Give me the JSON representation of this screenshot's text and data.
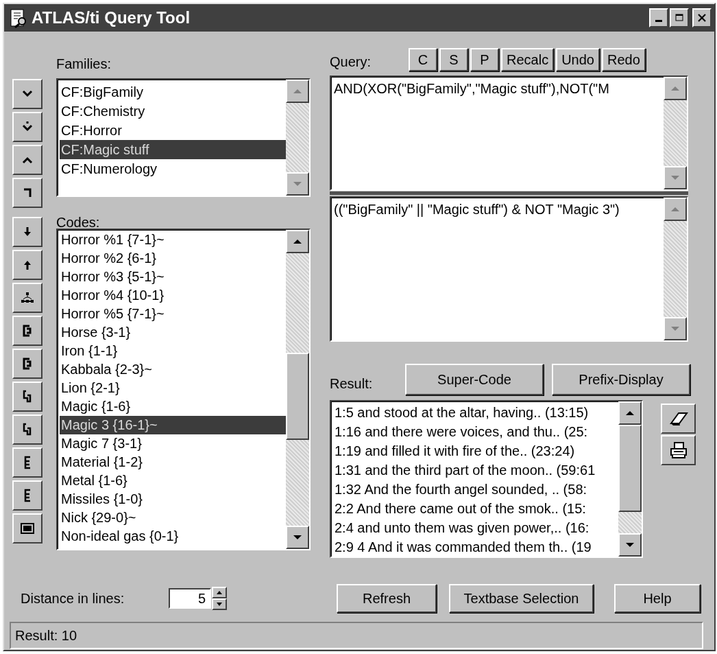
{
  "window": {
    "title": "ATLAS/ti Query Tool"
  },
  "families": {
    "label": "Families:",
    "scroll_enabled": false,
    "items": [
      {
        "text": "CF:BigFamily",
        "selected": false
      },
      {
        "text": "CF:Chemistry",
        "selected": false
      },
      {
        "text": "CF:Horror",
        "selected": false
      },
      {
        "text": "CF:Magic stuff",
        "selected": true
      },
      {
        "text": "CF:Numerology",
        "selected": false
      }
    ]
  },
  "codes": {
    "label": "Codes:",
    "scroll_enabled": true,
    "items": [
      {
        "text": "Horror %1 {7-1}~",
        "selected": false
      },
      {
        "text": "Horror %2 {6-1}",
        "selected": false
      },
      {
        "text": "Horror %3 {5-1}~",
        "selected": false
      },
      {
        "text": "Horror %4 {10-1}",
        "selected": false
      },
      {
        "text": "Horror %5 {7-1}~",
        "selected": false
      },
      {
        "text": "Horse {3-1}",
        "selected": false
      },
      {
        "text": "Iron {1-1}",
        "selected": false
      },
      {
        "text": "Kabbala {2-3}~",
        "selected": false
      },
      {
        "text": "Lion {2-1}",
        "selected": false
      },
      {
        "text": "Magic {1-6}",
        "selected": false
      },
      {
        "text": "Magic 3 {16-1}~",
        "selected": true
      },
      {
        "text": "Magic 7 {3-1}",
        "selected": false
      },
      {
        "text": "Material {1-2}",
        "selected": false
      },
      {
        "text": "Metal {1-6}",
        "selected": false
      },
      {
        "text": "Missiles {1-0}",
        "selected": false
      },
      {
        "text": "Nick {29-0}~",
        "selected": false
      },
      {
        "text": "Non-ideal gas {0-1}",
        "selected": false
      }
    ]
  },
  "query": {
    "label": "Query:",
    "buttons": [
      "C",
      "S",
      "P",
      "Recalc",
      "Undo",
      "Redo"
    ],
    "scroll_enabled": false,
    "expression": "AND(XOR(\"BigFamily\",\"Magic stuff\"),NOT(\"M",
    "infix": "((\"BigFamily\" || \"Magic stuff\") & NOT \"Magic 3\")"
  },
  "result": {
    "label": "Result:",
    "buttons": [
      "Super-Code",
      "Prefix-Display"
    ],
    "scroll_enabled": true,
    "items": [
      "1:5 and stood at the altar, having.. (13:15)",
      "1:16 and there were voices, and thu.. (25:",
      "1:19 and filled it with fire of the.. (23:24)",
      "1:31 and the third part of the moon.. (59:61",
      "1:32 And the fourth angel sounded, .. (58:",
      "2:2 And there came out of the smok.. (15:",
      "2:4 and unto them was given power,.. (16:",
      "2:9 4 And it was commanded them th.. (19"
    ]
  },
  "distance": {
    "label": "Distance in lines:",
    "value": "5"
  },
  "buttons": [
    "Refresh",
    "Textbase Selection",
    "Help"
  ],
  "status_bar": "Result: 10"
}
